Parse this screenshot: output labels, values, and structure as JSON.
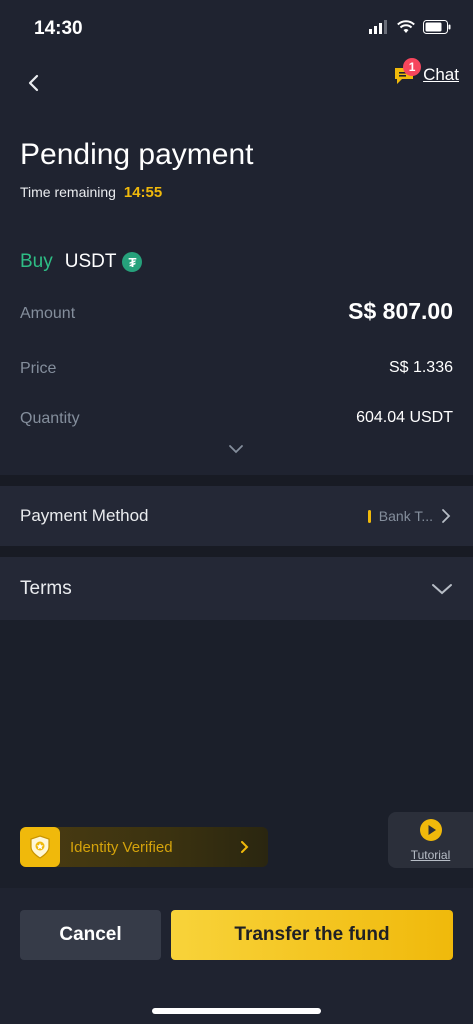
{
  "status_bar": {
    "time": "14:30"
  },
  "header": {
    "chat_label": "Chat",
    "chat_badge": "1"
  },
  "order": {
    "title": "Pending payment",
    "time_remaining_label": "Time remaining",
    "time_remaining_value": "14:55",
    "side": "Buy",
    "asset": "USDT",
    "details": [
      {
        "label": "Amount",
        "value": "S$ 807.00"
      },
      {
        "label": "Price",
        "value": "S$ 1.336"
      },
      {
        "label": "Quantity",
        "value": "604.04 USDT"
      }
    ]
  },
  "payment_method": {
    "label": "Payment Method",
    "value": "Bank T..."
  },
  "terms": {
    "label": "Terms"
  },
  "identity": {
    "label": "Identity Verified"
  },
  "tutorial": {
    "label": "Tutorial"
  },
  "actions": {
    "cancel": "Cancel",
    "transfer": "Transfer the fund"
  },
  "colors": {
    "buy_green": "#2ebd85",
    "accent_yellow": "#f0b90b",
    "background": "#1f2330"
  }
}
